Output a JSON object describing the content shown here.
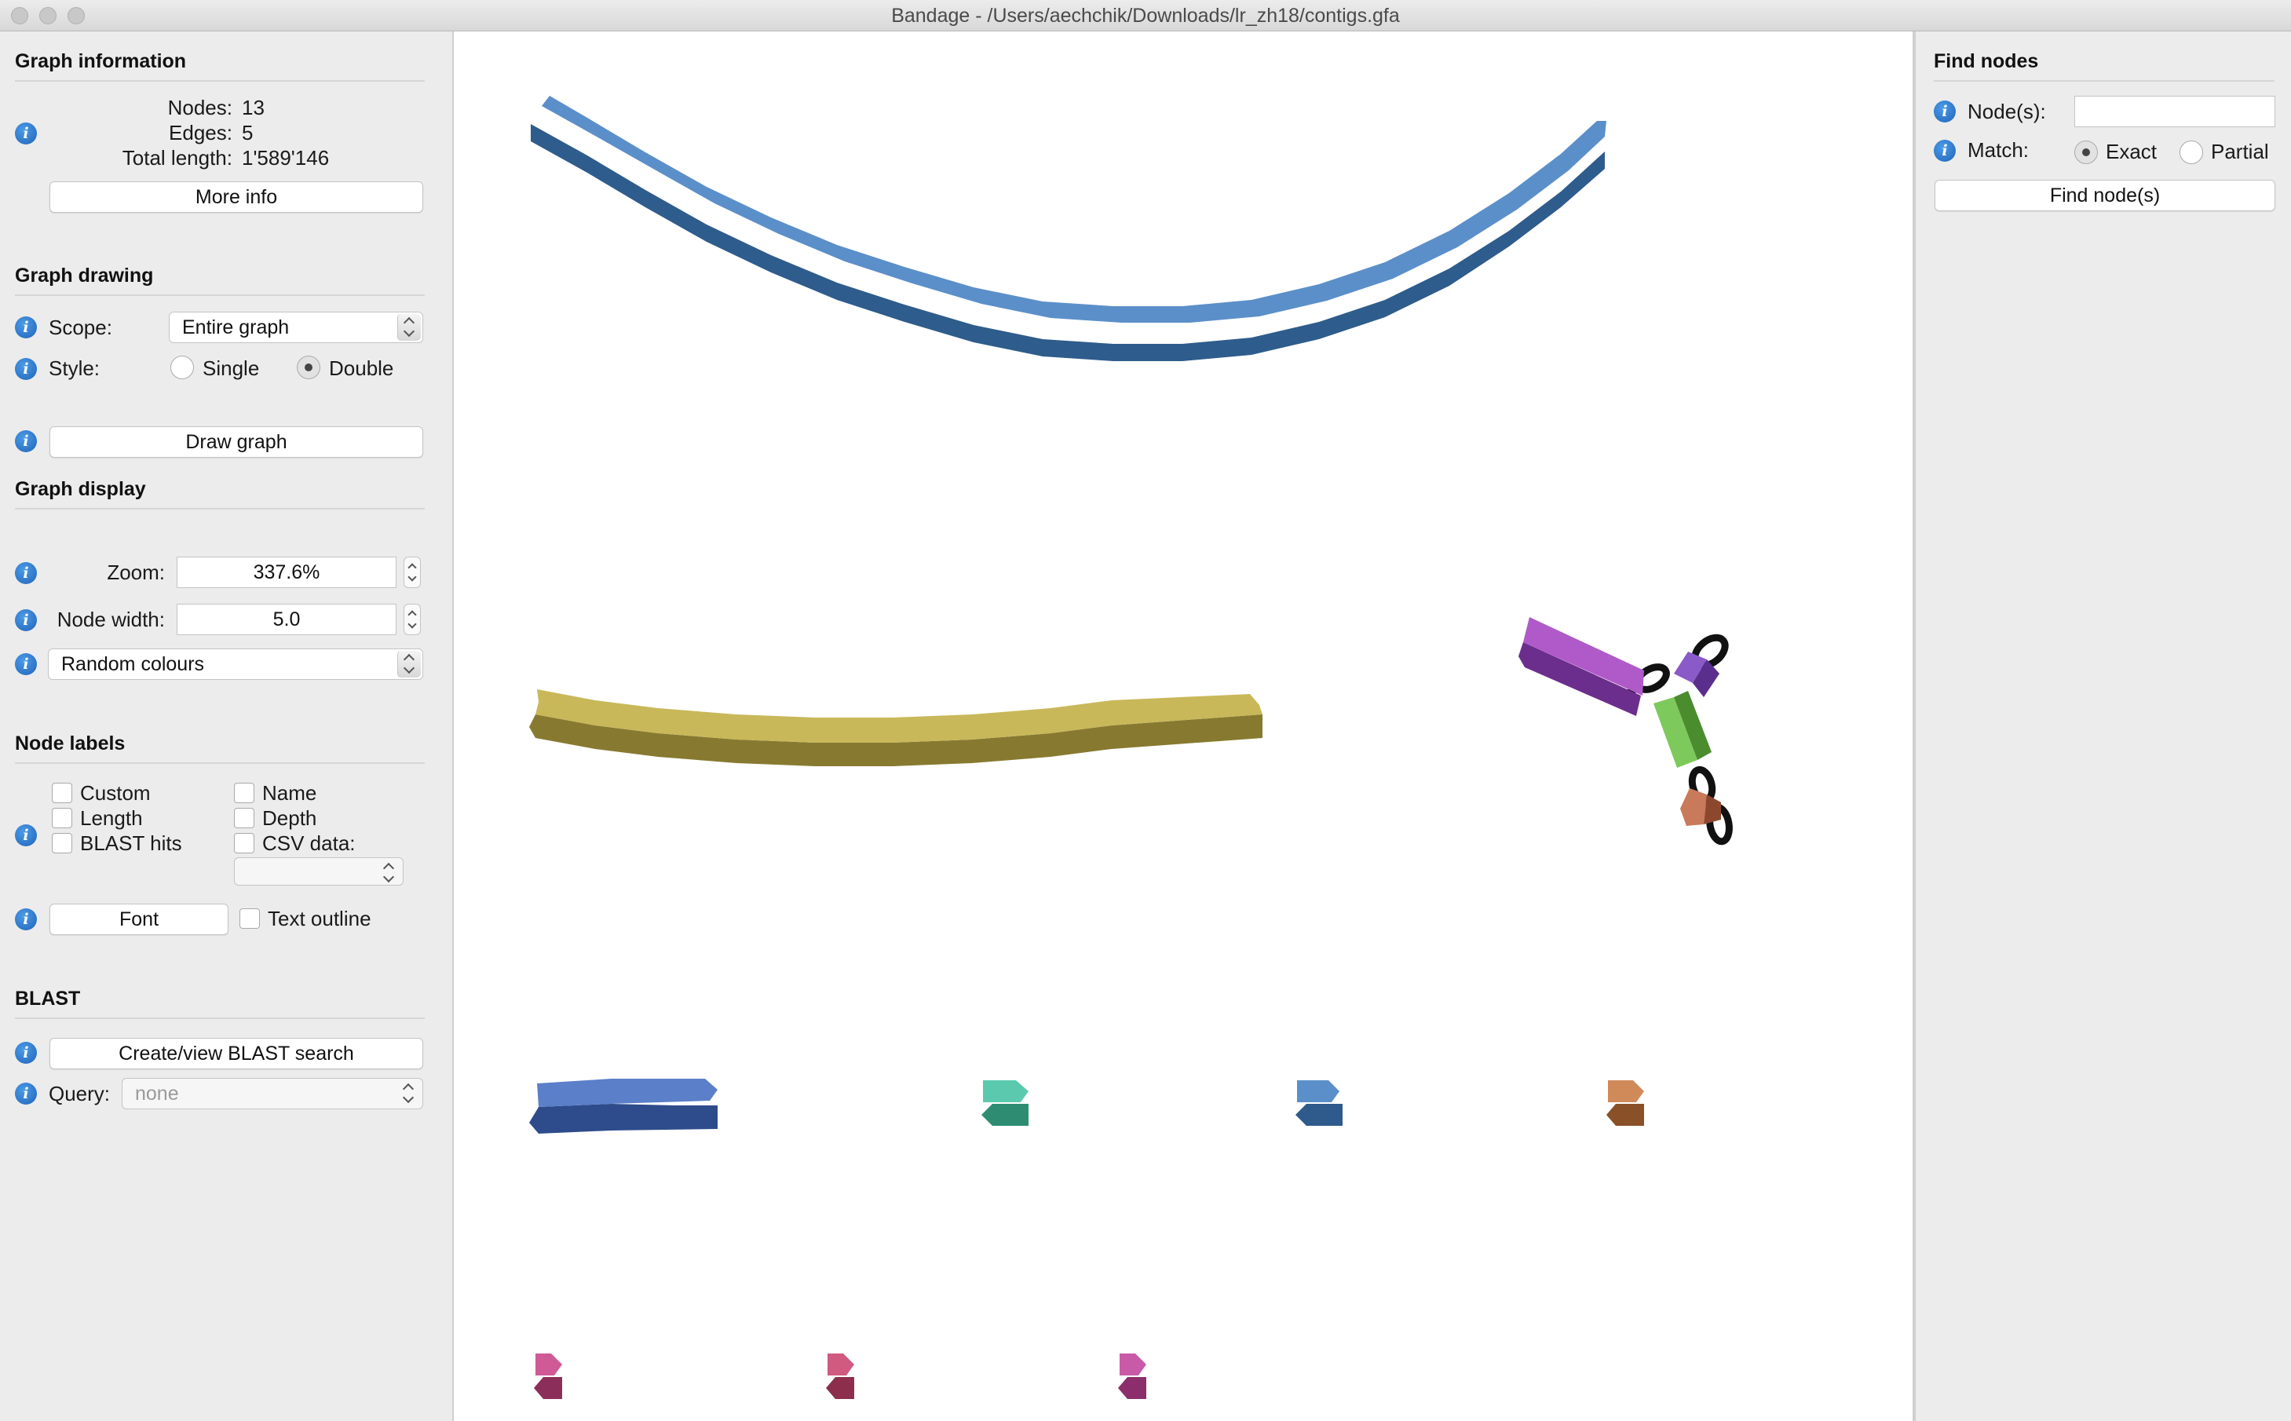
{
  "window": {
    "title": "Bandage - /Users/aechchik/Downloads/lr_zh18/contigs.gfa"
  },
  "graph_information": {
    "heading": "Graph information",
    "nodes_label": "Nodes:",
    "nodes_value": "13",
    "edges_label": "Edges:",
    "edges_value": "5",
    "total_length_label": "Total length:",
    "total_length_value": "1'589'146",
    "more_info_button": "More info"
  },
  "graph_drawing": {
    "heading": "Graph drawing",
    "scope_label": "Scope:",
    "scope_value": "Entire graph",
    "style_label": "Style:",
    "style_single": "Single",
    "style_double": "Double",
    "style_selected": "Double",
    "draw_graph_button": "Draw graph"
  },
  "graph_display": {
    "heading": "Graph display",
    "zoom_label": "Zoom:",
    "zoom_value": "337.6%",
    "node_width_label": "Node width:",
    "node_width_value": "5.0",
    "colour_scheme": "Random colours"
  },
  "node_labels": {
    "heading": "Node labels",
    "custom": "Custom",
    "length": "Length",
    "blast_hits": "BLAST hits",
    "name": "Name",
    "depth": "Depth",
    "csv_data": "CSV data:",
    "font_button": "Font",
    "text_outline": "Text outline"
  },
  "blast": {
    "heading": "BLAST",
    "create_button": "Create/view BLAST search",
    "query_label": "Query:",
    "query_value": "none"
  },
  "find_nodes": {
    "heading": "Find nodes",
    "nodes_label": "Node(s):",
    "nodes_value": "",
    "match_label": "Match:",
    "match_exact": "Exact",
    "match_partial": "Partial",
    "match_selected": "Exact",
    "find_button": "Find node(s)"
  },
  "graph_nodes": [
    {
      "id": "big-blue-arc",
      "color_top": "#5b8fc9",
      "color_bottom": "#2e5c8c"
    },
    {
      "id": "olive-arc",
      "color_top": "#c8b85a",
      "color_bottom": "#877a30"
    },
    {
      "id": "small-blue",
      "color_top": "#5b7fc9",
      "color_bottom": "#2e4c8c"
    },
    {
      "id": "teal",
      "color_top": "#5bc9ae",
      "color_bottom": "#2e8c72"
    },
    {
      "id": "steel-blue",
      "color_top": "#5b8fc9",
      "color_bottom": "#2e5a8c"
    },
    {
      "id": "tan",
      "color_top": "#d08a5a",
      "color_bottom": "#8a5028"
    },
    {
      "id": "pink-1",
      "color_top": "#d05a96",
      "color_bottom": "#8c2e5a"
    },
    {
      "id": "pink-2",
      "color_top": "#d05a80",
      "color_bottom": "#8c2e4c"
    },
    {
      "id": "pink-3",
      "color_top": "#c95aa8",
      "color_bottom": "#8c2e6c"
    },
    {
      "id": "purple",
      "color_top": "#b05ac9",
      "color_bottom": "#6c2e8c"
    },
    {
      "id": "violet",
      "color_top": "#8a5ac9",
      "color_bottom": "#5a2e8c"
    },
    {
      "id": "green",
      "color_top": "#7ec95b",
      "color_bottom": "#4a8c2e"
    },
    {
      "id": "rust",
      "color_top": "#c97a5b",
      "color_bottom": "#8c482e"
    }
  ]
}
